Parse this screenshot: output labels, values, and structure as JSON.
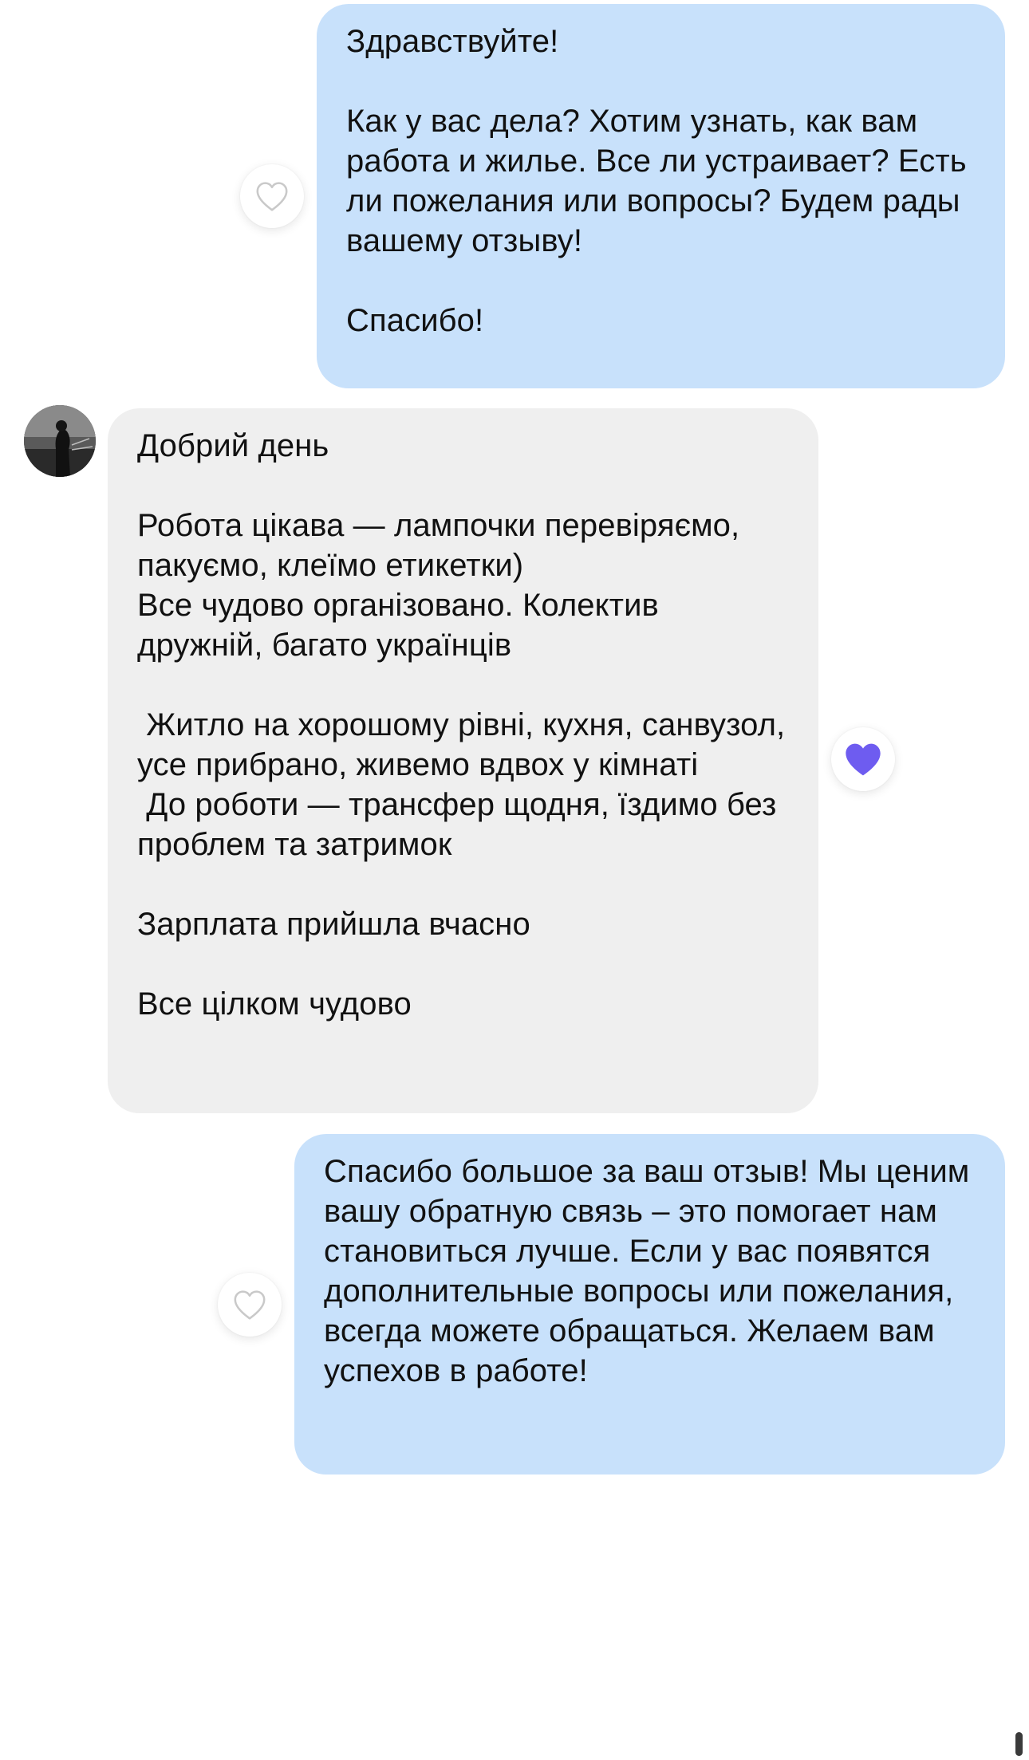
{
  "messages": [
    {
      "direction": "outgoing",
      "text": "Здравствуйте!\n\nКак у вас дела? Хотим узнать, как вам работа и жилье. Все ли устраивает? Есть ли пожелания или вопросы? Будем рады вашему отзыву!\n\nСпасибо!",
      "reaction": {
        "liked": false,
        "icon": "heart-outline-icon"
      }
    },
    {
      "direction": "incoming",
      "text": "Добрий день\n\nРобота цікава — лампочки перевіряємо, пакуємо, клеїмо етикетки)\nВсе чудово організовано. Колектив дружній, багато українців\n\n Житло на хорошому рівні, кухня, санвузол, усе прибрано, живемо вдвох у кімнаті\n До роботи — трансфер щодня, їздимо без проблем та затримок\n\nЗарплата прийшла вчасно\n\nВсе цілком чудово",
      "reaction": {
        "liked": true,
        "icon": "heart-filled-icon"
      }
    },
    {
      "direction": "outgoing",
      "text": "Спасибо большое за ваш отзыв! Мы ценим вашу обратную связь – это помогает нам становиться лучше. Если у вас появятся дополнительные вопросы или пожелания, всегда можете обращаться. Желаем вам успехов в работе!",
      "reaction": {
        "liked": false,
        "icon": "heart-outline-icon"
      }
    }
  ],
  "colors": {
    "outgoing_bubble": "#c8e1fb",
    "incoming_bubble": "#efefef",
    "heart_liked": "#6e5cf0",
    "heart_unliked": "#c9c9c9",
    "background": "#ffffff"
  }
}
